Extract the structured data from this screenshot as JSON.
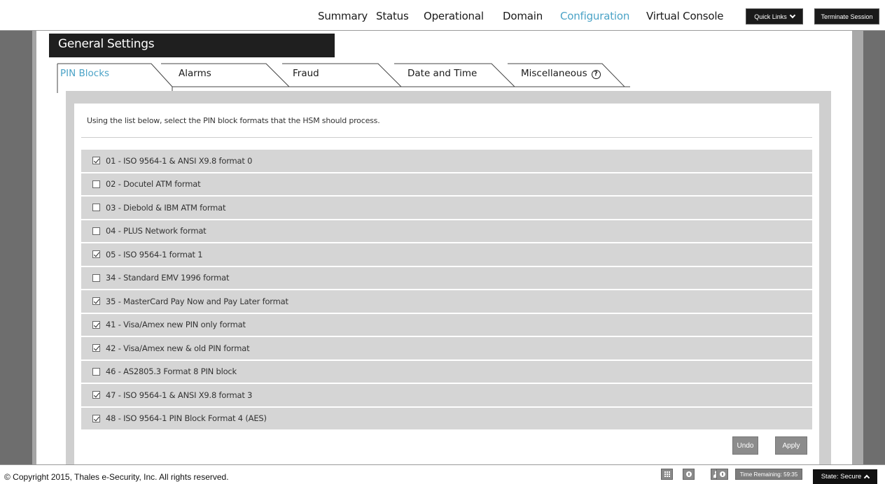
{
  "nav": {
    "items": [
      {
        "label": "Summary",
        "active": false
      },
      {
        "label": "Status",
        "active": false
      },
      {
        "label": "Operational",
        "active": false
      },
      {
        "label": "Domain",
        "active": false
      },
      {
        "label": "Configuration",
        "active": true
      },
      {
        "label": "Virtual Console",
        "active": false
      }
    ],
    "quick_links": "Quick Links",
    "terminate": "Terminate Session"
  },
  "section_title": "General Settings",
  "tabs": [
    {
      "label": "PIN Blocks",
      "active": true
    },
    {
      "label": "Alarms",
      "active": false
    },
    {
      "label": "Fraud",
      "active": false
    },
    {
      "label": "Date and Time",
      "active": false
    },
    {
      "label": "Miscellaneous",
      "active": false
    }
  ],
  "help_symbol": "?",
  "instruction": "Using the list below, select the PIN block formats that the HSM should process.",
  "pin_formats": [
    {
      "label": "01 - ISO 9564-1 & ANSI X9.8 format 0",
      "checked": true
    },
    {
      "label": "02 - Docutel ATM format",
      "checked": false
    },
    {
      "label": "03 - Diebold & IBM ATM format",
      "checked": false
    },
    {
      "label": "04 - PLUS Network format",
      "checked": false
    },
    {
      "label": "05 - ISO 9564-1 format 1",
      "checked": true
    },
    {
      "label": "34 - Standard EMV 1996 format",
      "checked": false
    },
    {
      "label": "35 - MasterCard Pay Now and Pay Later format",
      "checked": true
    },
    {
      "label": "41 - Visa/Amex new PIN only format",
      "checked": true
    },
    {
      "label": "42 - Visa/Amex new & old PIN format",
      "checked": true
    },
    {
      "label": "46 - AS2805.3 Format 8 PIN block",
      "checked": false
    },
    {
      "label": "47 - ISO 9564-1 & ANSI X9.8 format 3",
      "checked": true
    },
    {
      "label": "48 - ISO 9564-1 PIN Block Format 4 (AES)",
      "checked": true
    }
  ],
  "buttons": {
    "undo": "Undo",
    "apply": "Apply"
  },
  "footer": {
    "copyright": "© Copyright 2015, Thales e-Security, Inc. All rights reserved.",
    "time_remaining": "Time Remaining: 59:35",
    "state": "State: Secure",
    "icons": [
      "grid-icon",
      "info-icon",
      "user-icon",
      "info-icon"
    ]
  },
  "colors": {
    "accent": "#4ba3c7",
    "dark": "#1f1f1f",
    "row_bg": "#d5d5d5",
    "panel_gray": "#cfcfcf"
  }
}
